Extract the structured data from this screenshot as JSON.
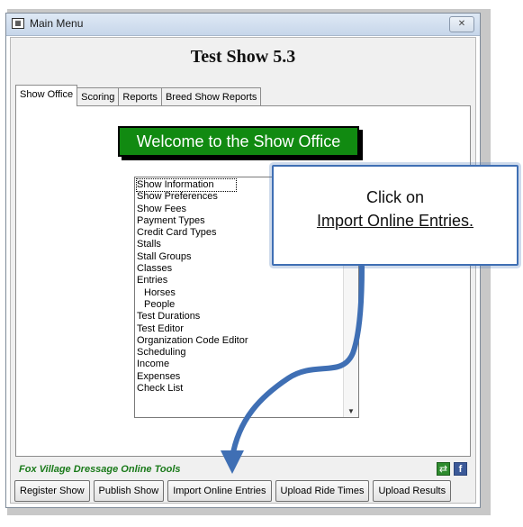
{
  "window": {
    "title": "Main Menu",
    "close_label": "✕"
  },
  "show_title": "Test Show 5.3",
  "tabs": [
    {
      "label": "Show Office",
      "active": true
    },
    {
      "label": "Scoring",
      "active": false
    },
    {
      "label": "Reports",
      "active": false
    },
    {
      "label": "Breed Show Reports",
      "active": false
    }
  ],
  "welcome_banner": "Welcome to the Show Office",
  "list": {
    "items": [
      {
        "label": "Show Information",
        "indent": false
      },
      {
        "label": "Show Preferences",
        "indent": false
      },
      {
        "label": "Show Fees",
        "indent": false
      },
      {
        "label": "Payment Types",
        "indent": false
      },
      {
        "label": "Credit Card Types",
        "indent": false
      },
      {
        "label": "Stalls",
        "indent": false
      },
      {
        "label": "Stall Groups",
        "indent": false
      },
      {
        "label": "Classes",
        "indent": false
      },
      {
        "label": "Entries",
        "indent": false
      },
      {
        "label": "Horses",
        "indent": true
      },
      {
        "label": "People",
        "indent": true
      },
      {
        "label": "Test Durations",
        "indent": false
      },
      {
        "label": "Test Editor",
        "indent": false
      },
      {
        "label": "Organization Code Editor",
        "indent": false
      },
      {
        "label": "Scheduling",
        "indent": false
      },
      {
        "label": "Income",
        "indent": false
      },
      {
        "label": "Expenses",
        "indent": false
      },
      {
        "label": "Check List",
        "indent": false
      }
    ]
  },
  "online_tools_label": "Fox Village Dressage Online Tools",
  "icons": {
    "site": "website-icon",
    "facebook": "facebook-icon",
    "facebook_glyph": "f"
  },
  "buttons": {
    "register_show": "Register Show",
    "publish_show": "Publish Show",
    "import_online_entries": "Import Online Entries",
    "upload_ride_times": "Upload Ride Times",
    "upload_results": "Upload Results"
  },
  "callout": {
    "line1": "Click on",
    "line2": "Import Online Entries."
  },
  "colors": {
    "banner_green": "#118a11",
    "tools_green": "#1a7a1a",
    "callout_blue": "#3f6fb4"
  }
}
